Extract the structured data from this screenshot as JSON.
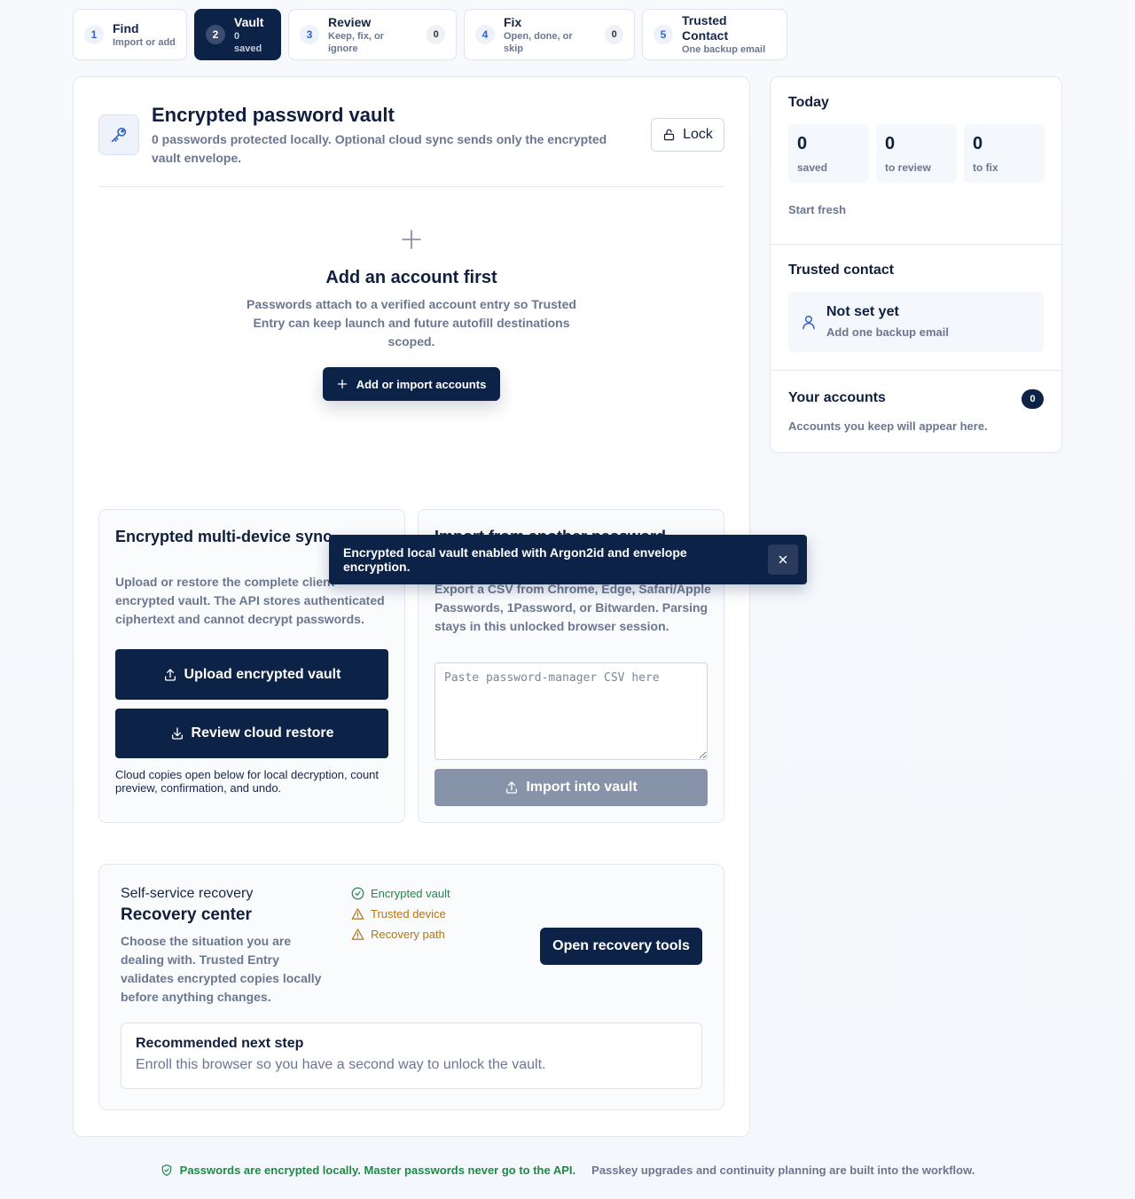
{
  "steps": [
    {
      "num": "1",
      "title": "Find",
      "sub": "Import or add"
    },
    {
      "num": "2",
      "title": "Vault",
      "sub": "0 saved"
    },
    {
      "num": "3",
      "title": "Review",
      "sub": "Keep, fix, or ignore",
      "count": "0"
    },
    {
      "num": "4",
      "title": "Fix",
      "sub": "Open, done, or skip",
      "count": "0"
    },
    {
      "num": "5",
      "title": "Trusted Contact",
      "sub": "One backup email"
    }
  ],
  "vault": {
    "title": "Encrypted password vault",
    "subtitle": "0 passwords protected locally. Optional cloud sync sends only the encrypted vault envelope.",
    "lock_label": "Lock"
  },
  "empty_state": {
    "icon": "plus-icon",
    "title": "Add an account first",
    "body": "Passwords attach to a verified account entry so Trusted Entry can keep launch and future autofill destinations scoped.",
    "button_label": "Add or import accounts"
  },
  "sync": {
    "title": "Encrypted multi-device sync",
    "body": "Upload or restore the complete client encrypted vault. The API stores authenticated ciphertext and cannot decrypt passwords.",
    "upload_label": "Upload encrypted vault",
    "restore_label": "Review cloud restore",
    "note": "Cloud copies open below for local decryption, count preview, confirmation, and undo."
  },
  "import": {
    "title": "Import from another password manager",
    "body": "Export a CSV from Chrome, Edge, Safari/Apple Passwords, 1Password, or Bitwarden. Parsing stays in this unlocked browser session.",
    "placeholder": "Paste password-manager CSV here",
    "button_label": "Import into vault"
  },
  "toast": {
    "message": "Encrypted local vault enabled with Argon2id and envelope encryption."
  },
  "recovery": {
    "kicker": "Self-service recovery",
    "title": "Recovery center",
    "body": "Choose the situation you are dealing with. Trusted Entry validates encrypted copies locally before anything changes.",
    "checks": [
      {
        "label": "Encrypted vault",
        "status": "ok"
      },
      {
        "label": "Trusted device",
        "status": "warn"
      },
      {
        "label": "Recovery path",
        "status": "warn"
      }
    ],
    "open_label": "Open recovery tools",
    "next_title": "Recommended next step",
    "next_body": "Enroll this browser so you have a second way to unlock the vault."
  },
  "sidebar": {
    "today_title": "Today",
    "stats": [
      {
        "value": "0",
        "label": "saved"
      },
      {
        "value": "0",
        "label": "to review"
      },
      {
        "value": "0",
        "label": "to fix"
      }
    ],
    "start_fresh": "Start fresh",
    "contact_title": "Trusted contact",
    "contact_status": "Not set yet",
    "contact_sub": "Add one backup email",
    "accounts_title": "Your accounts",
    "accounts_count": "0",
    "accounts_empty": "Accounts you keep will appear here."
  },
  "footer": {
    "security": "Passwords are encrypted locally. Master passwords never go to the API.",
    "note": "Passkey upgrades and continuity planning are built into the workflow."
  },
  "colors": {
    "navy": "#0d2247",
    "success": "#1d8a4a",
    "warning": "#b7740f",
    "muted": "#6b7790"
  }
}
